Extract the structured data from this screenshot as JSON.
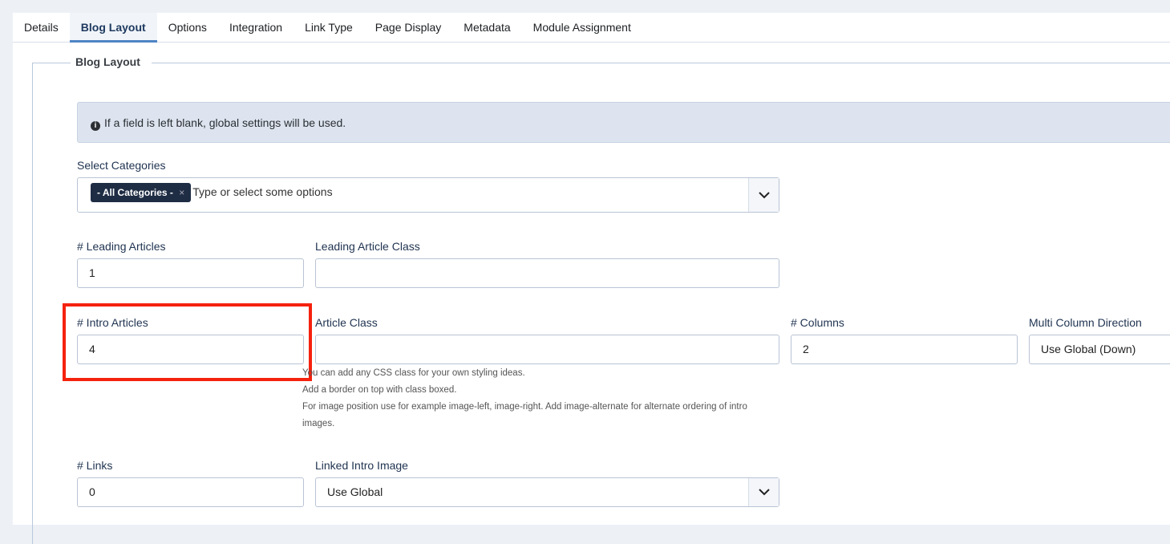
{
  "tabs": [
    "Details",
    "Blog Layout",
    "Options",
    "Integration",
    "Link Type",
    "Page Display",
    "Metadata",
    "Module Assignment"
  ],
  "fieldset_legend": "Blog Layout",
  "alert": "If a field is left blank, global settings will be used.",
  "select_categories": {
    "label": "Select Categories",
    "chip": "- All Categories -",
    "chip_remove": "×",
    "placeholder": "Type or select some options"
  },
  "leading_articles": {
    "label": "# Leading Articles",
    "value": "1"
  },
  "leading_article_class": {
    "label": "Leading Article Class",
    "value": ""
  },
  "intro_articles": {
    "label": "# Intro Articles",
    "value": "4"
  },
  "article_class": {
    "label": "Article Class",
    "value": "",
    "help": [
      "You can add any CSS class for your own styling ideas.",
      "Add a border on top with class boxed.",
      "For image position use for example image-left, image-right. Add image-alternate for alternate ordering of intro images."
    ]
  },
  "columns": {
    "label": "# Columns",
    "value": "2"
  },
  "multi_column_direction": {
    "label": "Multi Column Direction",
    "value": "Use Global (Down)"
  },
  "links": {
    "label": "# Links",
    "value": "0"
  },
  "linked_intro_image": {
    "label": "Linked Intro Image",
    "value": "Use Global"
  },
  "highlight_color": "#f5220e"
}
